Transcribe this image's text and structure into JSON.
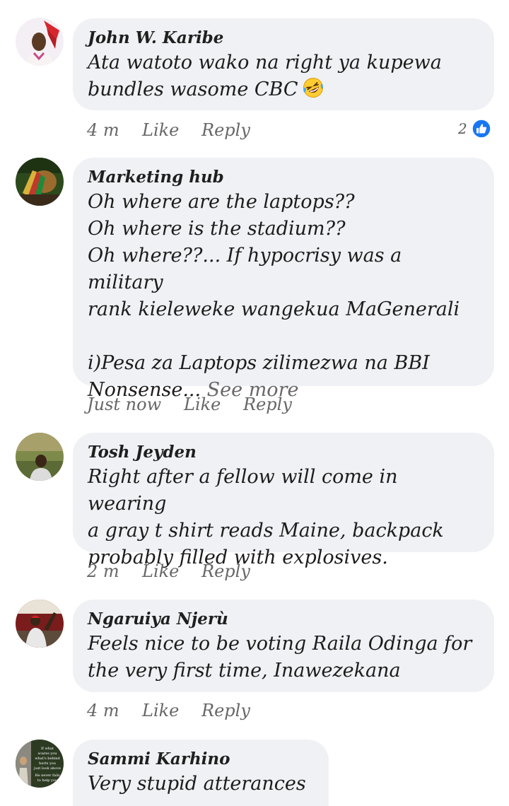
{
  "comments": [
    {
      "author": "John W. Karibe",
      "text": "Ata watoto wako na right ya kupewa\nbundles wasome CBC",
      "emoji": "rolling-on-floor-laughing-emoji",
      "time": "4 m",
      "like": "Like",
      "reply": "Reply",
      "reaction_count": "2",
      "reaction_icon": "thumbs-up-icon"
    },
    {
      "author": "Marketing hub",
      "text": "Oh where are the laptops??\nOh where is the stadium??\nOh where??... If hypocrisy was a military\nrank kieleweke wangekua MaGenerali\n\ni)Pesa za Laptops zilimezwa na BBI\nNonsense...",
      "see_more": "See more",
      "time": "Just now",
      "like": "Like",
      "reply": "Reply"
    },
    {
      "author": "Tosh Jeyden",
      "text": "Right after a fellow will come in wearing\na gray t shirt reads Maine, backpack\nprobably filled with explosives.",
      "time": "2 m",
      "like": "Like",
      "reply": "Reply"
    },
    {
      "author": "Ngaruiya Njerù",
      "text": "Feels nice to be voting Raila Odinga for\nthe very first time, Inawezekana",
      "time": "4 m",
      "like": "Like",
      "reply": "Reply"
    },
    {
      "author": "Sammi Karhino",
      "text": "Very stupid atterances",
      "avatar_text": "If what\nscares you\nwhat's behind\nhurts you\njust look above\nHe never fails\nto help you"
    }
  ],
  "colors": {
    "bubble": "#eff1f4",
    "meta_text": "#676767",
    "like_blue": "#1877f2"
  }
}
